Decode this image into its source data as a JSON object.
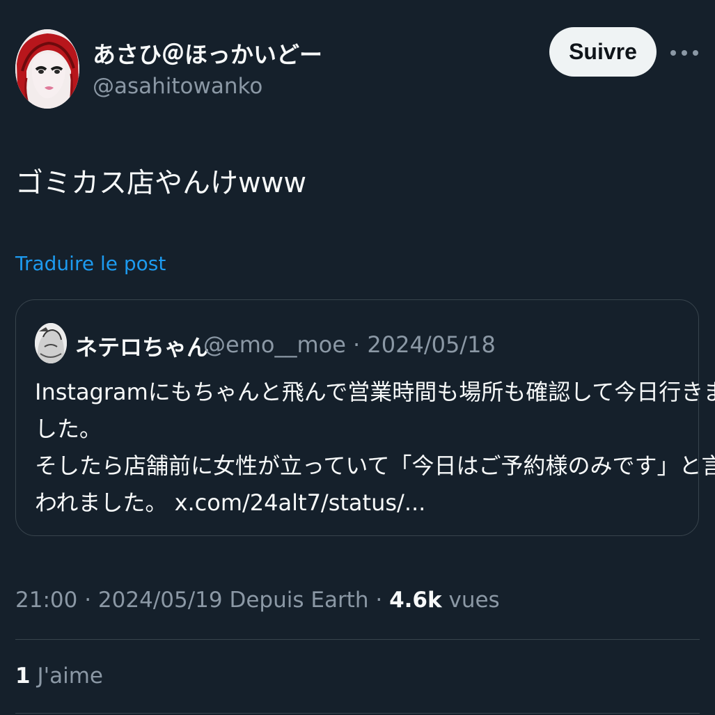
{
  "author": {
    "display_name": "あさひ＠ほっかいどー",
    "handle": "@asahitowanko"
  },
  "follow_button_label": "Suivre",
  "tweet": {
    "text": "ゴミカス店やんけwww",
    "translate_label": "Traduire le post"
  },
  "quoted_post": {
    "display_name": "ネテロちゃん",
    "handle": "@emo__moe",
    "separator": "·",
    "date": "2024/05/18",
    "lines": [
      "Instagramにもちゃんと飛んで営業時間も場所も確認して今日行きま",
      "した。",
      "そしたら店舗前に女性が立っていて「今日はご予約様のみです」と言",
      "われました。 x.com/24alt7/status/..."
    ]
  },
  "meta": {
    "time": "21:00",
    "separator": "·",
    "date": "2024/05/19",
    "source": "Depuis Earth",
    "views_count": "4.6k",
    "views_label": "vues"
  },
  "likes": {
    "count": "1",
    "label": "J'aime"
  },
  "colors": {
    "background": "#15202b",
    "primary_text": "#f7f9f9",
    "secondary_text": "#8b98a5",
    "link": "#1d9bf0",
    "border": "#38444d",
    "follow_button_bg": "#eff3f4"
  },
  "icons": {
    "more": "more-horizontal-icon"
  }
}
